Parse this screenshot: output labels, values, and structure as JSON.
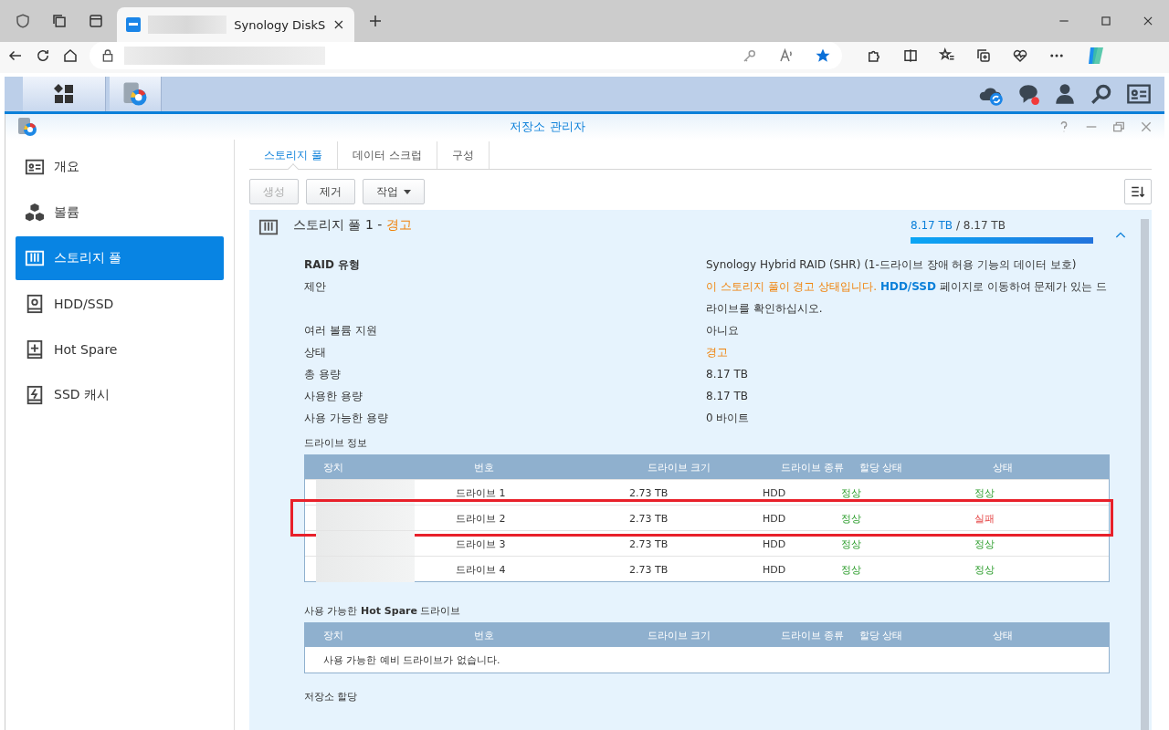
{
  "browser": {
    "tab_title": "Synology DiskS"
  },
  "window": {
    "title": "저장소 관리자"
  },
  "sidebar": {
    "items": [
      {
        "label": "개요",
        "selected": false
      },
      {
        "label": "볼륨",
        "selected": false
      },
      {
        "label": "스토리지 풀",
        "selected": true
      },
      {
        "label": "HDD/SSD",
        "selected": false
      },
      {
        "label": "Hot Spare",
        "selected": false
      },
      {
        "label": "SSD 캐시",
        "selected": false
      }
    ]
  },
  "tabs": [
    {
      "label": "스토리지 풀",
      "selected": true
    },
    {
      "label": "데이터 스크럽",
      "selected": false
    },
    {
      "label": "구성",
      "selected": false
    }
  ],
  "toolbar": {
    "buttons": [
      {
        "label": "생성",
        "disabled": true,
        "dropdown": false
      },
      {
        "label": "제거",
        "disabled": false,
        "dropdown": false
      },
      {
        "label": "작업",
        "disabled": false,
        "dropdown": true
      }
    ]
  },
  "pool": {
    "name": "스토리지 풀 1",
    "title_separator": "-",
    "status": "경고",
    "used": "8.17 TB",
    "usage_separator": "/",
    "total": "8.17 TB",
    "level": 1.0,
    "expanded": true,
    "details": [
      {
        "label": "RAID 유형",
        "parts": [
          {
            "kind": "plain",
            "text": "Synology Hybrid RAID (SHR) (1-드라이브 장애 허용 기능의 데이터 보호)"
          }
        ]
      },
      {
        "label": "제안",
        "parts": [
          {
            "kind": "warning",
            "text": "이 스토리지 풀이 경고 상태입니다. "
          },
          {
            "kind": "link",
            "text": "HDD/SSD"
          },
          {
            "kind": "plain",
            "text": " 페이지로 이동하여 문제가 있는 드라이브를 확인하십시오."
          }
        ]
      },
      {
        "label": "여러 볼륨 지원",
        "parts": [
          {
            "kind": "plain",
            "text": "아니요"
          }
        ]
      },
      {
        "label": "상태",
        "parts": [
          {
            "kind": "warning",
            "text": "경고"
          }
        ]
      },
      {
        "label": "총 용량",
        "parts": [
          {
            "kind": "plain",
            "text": "8.17 TB"
          }
        ]
      },
      {
        "label": "사용한 용량",
        "parts": [
          {
            "kind": "plain",
            "text": "8.17 TB"
          }
        ]
      },
      {
        "label": "사용 가능한 용량",
        "parts": [
          {
            "kind": "plain",
            "text": "0 바이트"
          }
        ]
      }
    ],
    "drive_info": {
      "title": "드라이브 정보",
      "columns": [
        "장치",
        "번호",
        "드라이브 크기",
        "드라이브 종류",
        "할당 상태",
        "상태"
      ],
      "rows": [
        {
          "number": "드라이브 1",
          "size": "2.73 TB",
          "type": "HDD",
          "allocation": {
            "text": "정상",
            "kind": "ok"
          },
          "status": {
            "text": "정상",
            "kind": "ok"
          },
          "highlighted": false
        },
        {
          "number": "드라이브 2",
          "size": "2.73 TB",
          "type": "HDD",
          "allocation": {
            "text": "정상",
            "kind": "ok"
          },
          "status": {
            "text": "실패",
            "kind": "fail"
          },
          "highlighted": true
        },
        {
          "number": "드라이브 3",
          "size": "2.73 TB",
          "type": "HDD",
          "allocation": {
            "text": "정상",
            "kind": "ok"
          },
          "status": {
            "text": "정상",
            "kind": "ok"
          },
          "highlighted": false
        },
        {
          "number": "드라이브 4",
          "size": "2.73 TB",
          "type": "HDD",
          "allocation": {
            "text": "정상",
            "kind": "ok"
          },
          "status": {
            "text": "정상",
            "kind": "ok"
          },
          "highlighted": false
        }
      ]
    },
    "hot_spare": {
      "title_parts": "사용 가능한 **Hot Spare** 드라이브",
      "columns": [
        "장치",
        "번호",
        "드라이브 크기",
        "드라이브 종류",
        "할당 상태",
        "상태"
      ],
      "empty": "사용 가능한 예비 드라이브가 없습니다."
    },
    "next_section": "저장소 할당"
  }
}
